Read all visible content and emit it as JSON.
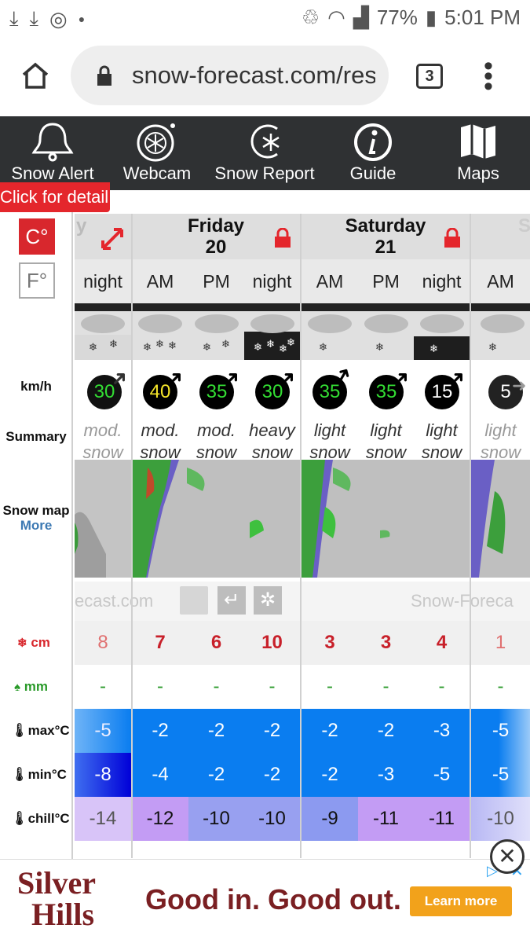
{
  "status": {
    "battery": "77%",
    "time": "5:01 PM"
  },
  "browser": {
    "url": "snow-forecast.com/res",
    "tab_count": "3"
  },
  "nav": [
    {
      "label": "Snow Alert",
      "icon": "bell-icon"
    },
    {
      "label": "Webcam",
      "icon": "webcam-icon"
    },
    {
      "label": "Snow Report",
      "icon": "snow-report-icon"
    },
    {
      "label": "Guide",
      "icon": "info-icon"
    },
    {
      "label": "Maps",
      "icon": "map-icon"
    }
  ],
  "detail_tip": "Click for detail",
  "units": {
    "celsius": "C°",
    "fahrenheit": "F°"
  },
  "row_labels": {
    "wind": "km/h",
    "summary": "Summary",
    "snowmap": "Snow map",
    "snowmap_more": "More",
    "snow": "cm",
    "rain": "mm",
    "max": "max°C",
    "min": "min°C",
    "chill": "chill°C"
  },
  "days": [
    {
      "name": "y",
      "num": ""
    },
    {
      "name": "Friday",
      "num": "20"
    },
    {
      "name": "Saturday",
      "num": "21"
    },
    {
      "name": "S",
      "num": ""
    }
  ],
  "periods": [
    "night",
    "AM",
    "PM",
    "night",
    "AM",
    "PM",
    "night",
    "AM"
  ],
  "wind_speeds": [
    "30",
    "40",
    "35",
    "30",
    "35",
    "35",
    "15",
    "5"
  ],
  "summaries": [
    [
      "mod.",
      "snow"
    ],
    [
      "mod.",
      "snow"
    ],
    [
      "mod.",
      "snow"
    ],
    [
      "heavy",
      "snow"
    ],
    [
      "light",
      "snow"
    ],
    [
      "light",
      "snow"
    ],
    [
      "light",
      "snow"
    ],
    [
      "light",
      "snow"
    ]
  ],
  "credit_left": "ecast.com",
  "credit_right": "Snow-Foreca",
  "snow_cm": [
    "8",
    "7",
    "6",
    "10",
    "3",
    "3",
    "4",
    "1"
  ],
  "rain_mm": [
    "-",
    "-",
    "-",
    "-",
    "-",
    "-",
    "-",
    "-"
  ],
  "max_c": [
    "-5",
    "-2",
    "-2",
    "-2",
    "-2",
    "-2",
    "-3",
    "-5"
  ],
  "min_c": [
    "-8",
    "-4",
    "-2",
    "-2",
    "-2",
    "-3",
    "-5",
    "-5"
  ],
  "chill_c": [
    "-14",
    "-12",
    "-10",
    "-10",
    "-9",
    "-11",
    "-11",
    "-10"
  ],
  "ad": {
    "brand_line1": "Silver",
    "brand_line2": "Hills",
    "tagline": "Good in. Good out.",
    "cta": "Learn more"
  },
  "colors": {
    "nav_bg": "#2f3133",
    "alert_red": "#e4262c",
    "temp_blue": "#0a7df0",
    "chill_purple": "#c39cf4"
  }
}
